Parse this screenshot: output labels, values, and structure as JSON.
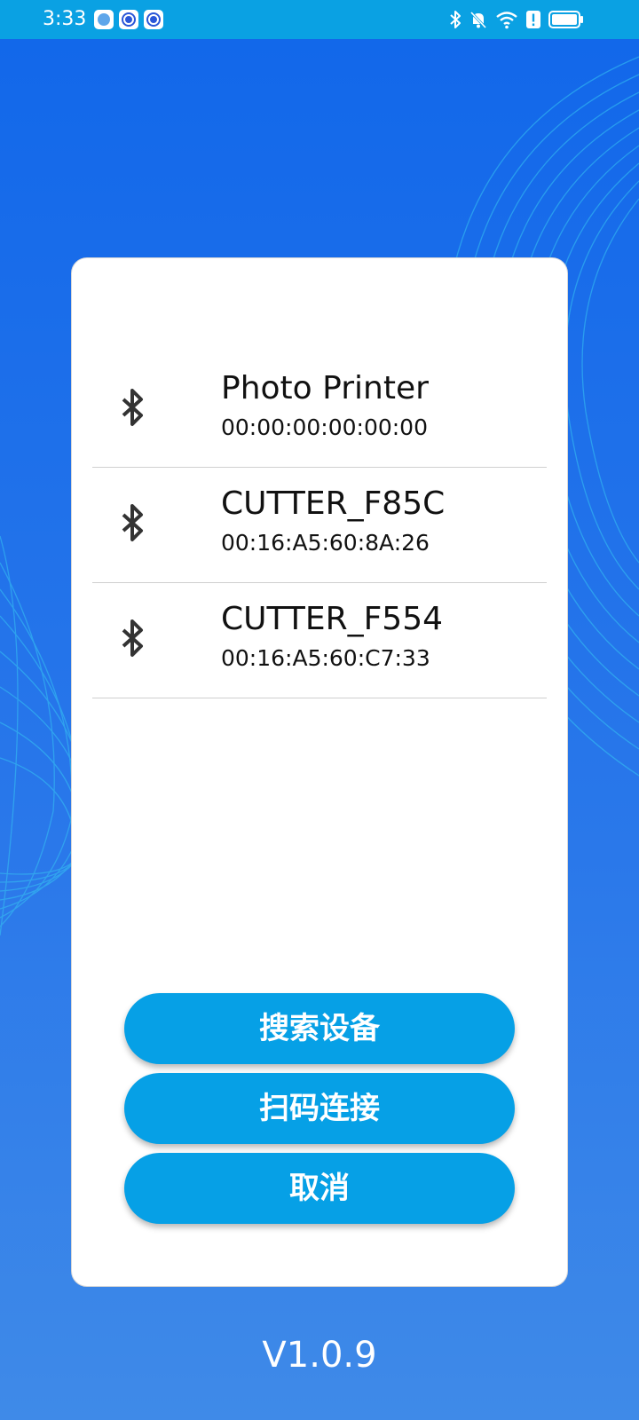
{
  "status_bar": {
    "time": "3:33",
    "app_icons": [
      "globe-app-icon",
      "circle-app-icon",
      "circle-app-icon"
    ],
    "right_icons": [
      "bluetooth-icon",
      "notifications-off-icon",
      "wifi-icon",
      "alert-icon",
      "battery-icon"
    ]
  },
  "devices": [
    {
      "name": "Photo Printer",
      "address": "00:00:00:00:00:00"
    },
    {
      "name": "CUTTER_F85C",
      "address": "00:16:A5:60:8A:26"
    },
    {
      "name": "CUTTER_F554",
      "address": "00:16:A5:60:C7:33"
    }
  ],
  "buttons": {
    "search": "搜索设备",
    "scan": "扫码连接",
    "cancel": "取消"
  },
  "version": "V1.0.9",
  "colors": {
    "status_bar": "#0aa1e3",
    "background_top": "#1167ea",
    "background_bottom": "#3f8ae8",
    "button": "#06a0e6"
  }
}
